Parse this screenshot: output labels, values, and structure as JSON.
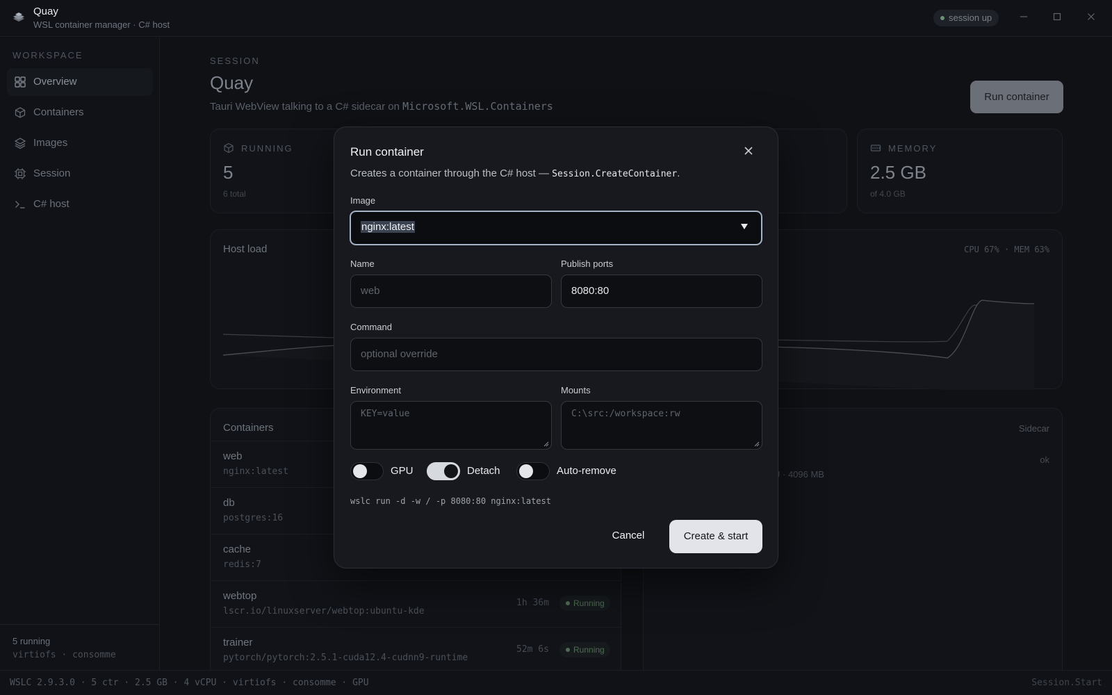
{
  "app": {
    "name": "Quay",
    "subtitle": "WSL container manager · C# host",
    "session_status": "session up"
  },
  "sidebar": {
    "section_label": "WORKSPACE",
    "items": [
      {
        "label": "Overview",
        "icon": "grid-icon",
        "active": true
      },
      {
        "label": "Containers",
        "icon": "cube-icon"
      },
      {
        "label": "Images",
        "icon": "layers-icon"
      },
      {
        "label": "Session",
        "icon": "chip-icon"
      },
      {
        "label": "C# host",
        "icon": "terminal-icon"
      }
    ],
    "footer_line1": "5 running",
    "footer_line2": "virtiofs · consomme"
  },
  "page": {
    "section_label": "SESSION",
    "title": "Quay",
    "subtitle_prefix": "Tauri WebView talking to a C# sidecar on ",
    "subtitle_code": "Microsoft.WSL.Containers",
    "run_button": "Run container"
  },
  "stats": {
    "running": {
      "label": "RUNNING",
      "value": "5",
      "sub": "6 total"
    },
    "memory": {
      "label": "MEMORY",
      "value": "2.5 GB",
      "sub": "of 4.0 GB"
    }
  },
  "host_load": {
    "title": "Host load",
    "meta": "CPU 67% · MEM 63%"
  },
  "containers_panel": {
    "title": "Containers",
    "rows": [
      {
        "name": "web",
        "image": "nginx:latest",
        "uptime": "",
        "status": ""
      },
      {
        "name": "db",
        "image": "postgres:16",
        "uptime": "",
        "status": ""
      },
      {
        "name": "cache",
        "image": "redis:7",
        "uptime": "",
        "status": ""
      },
      {
        "name": "webtop",
        "image": "lscr.io/linuxserver/webtop:ubuntu-kde",
        "uptime": "1h 36m",
        "status": "Running"
      },
      {
        "name": "trainer",
        "image": "pytorch/pytorch:2.5.1-cuda12.4-cudnn9-runtime",
        "uptime": "52m 6s",
        "status": "Running"
      }
    ]
  },
  "sidecar_panel": {
    "title": "Sidecar",
    "status": "ok",
    "detail": "U · 4096 MB"
  },
  "statusbar": {
    "left": "WSLC 2.9.3.0 · 5 ctr · 2.5 GB · 4 vCPU · virtiofs · consomme · GPU",
    "right": "Session.Start"
  },
  "modal": {
    "title": "Run container",
    "desc_prefix": "Creates a container through the C# host — ",
    "desc_code": "Session.CreateContainer",
    "desc_suffix": ".",
    "image_label": "Image",
    "image_value": "nginx:latest",
    "name_label": "Name",
    "name_placeholder": "web",
    "ports_label": "Publish ports",
    "ports_value": "8080:80",
    "command_label": "Command",
    "command_placeholder": "optional override",
    "env_label": "Environment",
    "env_placeholder": "KEY=value",
    "mounts_label": "Mounts",
    "mounts_placeholder": "C:\\src:/workspace:rw",
    "toggles": [
      {
        "label": "GPU",
        "on": false
      },
      {
        "label": "Detach",
        "on": true
      },
      {
        "label": "Auto-remove",
        "on": false
      }
    ],
    "command_preview": "wslc run -d -w / -p 8080:80 nginx:latest",
    "cancel_label": "Cancel",
    "create_label": "Create & start"
  },
  "colors": {
    "background": "#0f1115",
    "modal": "#17191e",
    "primary_button": "#e2e4e9",
    "running_badge": "#4f6b55",
    "focus_ring": "#a5b3c6"
  }
}
